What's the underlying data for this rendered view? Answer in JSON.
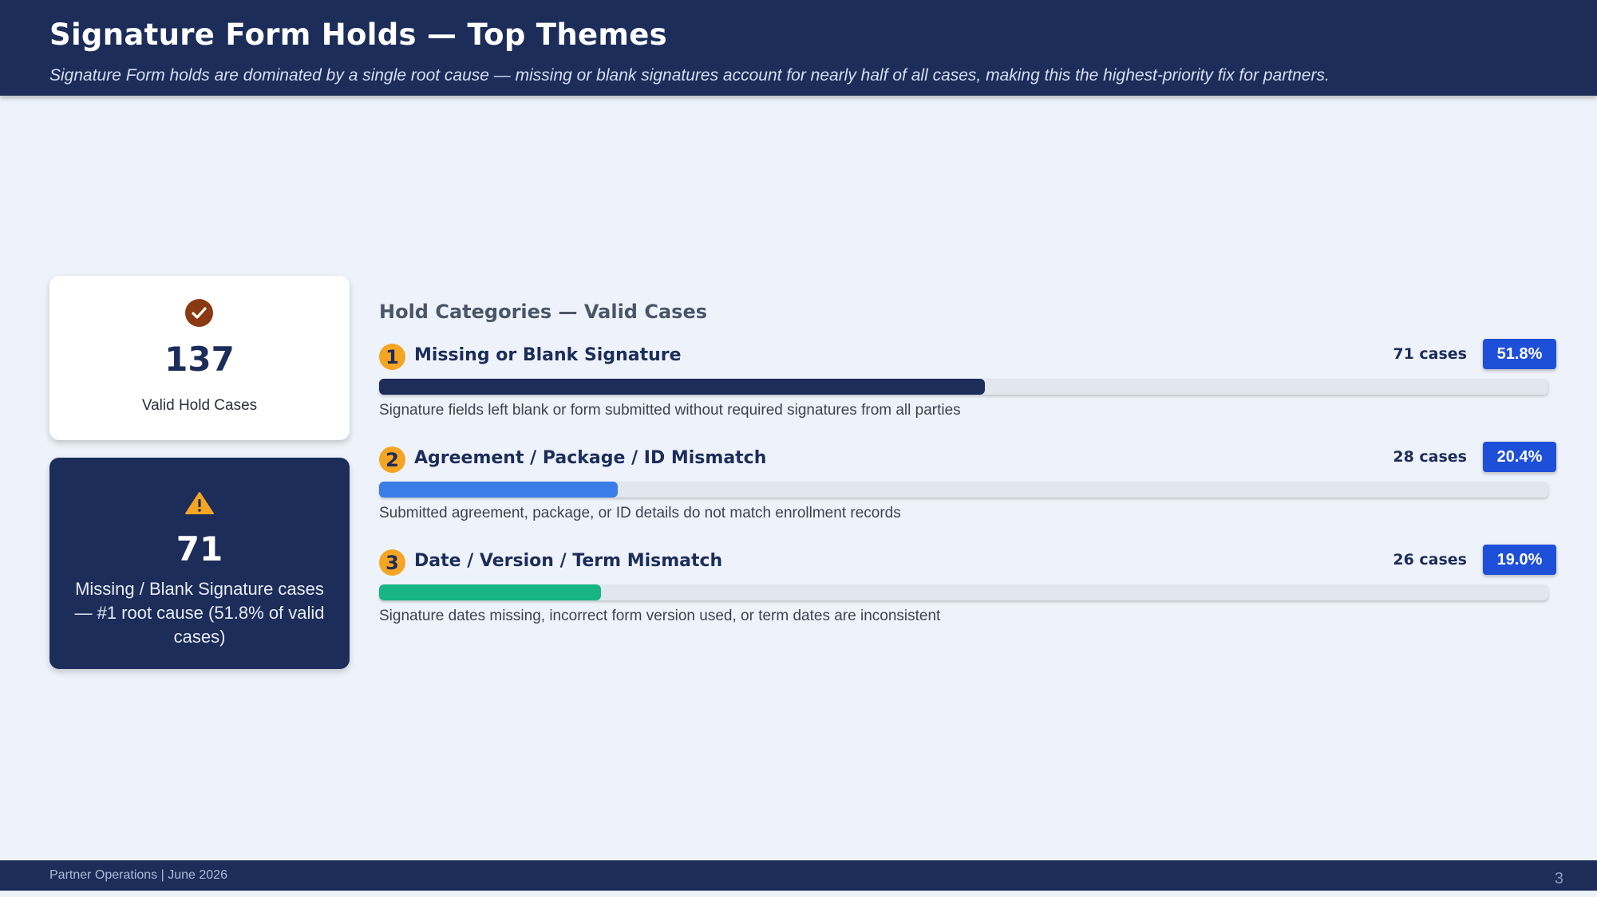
{
  "header": {
    "title": "Signature Form Holds — Top Themes",
    "subtitle": "Signature Form holds are dominated by a single root cause — missing or blank signatures account for nearly half of all cases, making this the highest-priority fix for partners."
  },
  "kpi_cards": [
    {
      "icon": "check-circle-icon",
      "value": "137",
      "label": "Valid Hold Cases"
    },
    {
      "icon": "warning-triangle-icon",
      "value": "71",
      "label": "Missing / Blank Signature cases — #1 root cause (51.8% of valid cases)"
    }
  ],
  "section": {
    "title": "Hold Categories — Valid Cases",
    "categories": [
      {
        "rank": "1",
        "name": "Missing or Blank Signature",
        "cases": "71 cases",
        "pct": "51.8%",
        "fill_fraction": 0.518,
        "color": "#1c2d5a",
        "desc": "Signature fields left blank or form submitted without required signatures from all parties"
      },
      {
        "rank": "2",
        "name": "Agreement / Package / ID Mismatch",
        "cases": "28 cases",
        "pct": "20.4%",
        "fill_fraction": 0.204,
        "color": "#3b7de8",
        "desc": "Submitted agreement, package, or ID details do not match enrollment records"
      },
      {
        "rank": "3",
        "name": "Date / Version / Term Mismatch",
        "cases": "26 cases",
        "pct": "19.0%",
        "fill_fraction": 0.19,
        "color": "#17b582",
        "desc": "Signature dates missing, incorrect form version used, or term dates are inconsistent"
      }
    ]
  },
  "footer": {
    "text": "Partner Operations | June 2026",
    "page": "3"
  },
  "colors": {
    "header_bg": "#1c2d5a",
    "accent_badge": "#1e4fd8",
    "rank_badge": "#f5a524"
  }
}
